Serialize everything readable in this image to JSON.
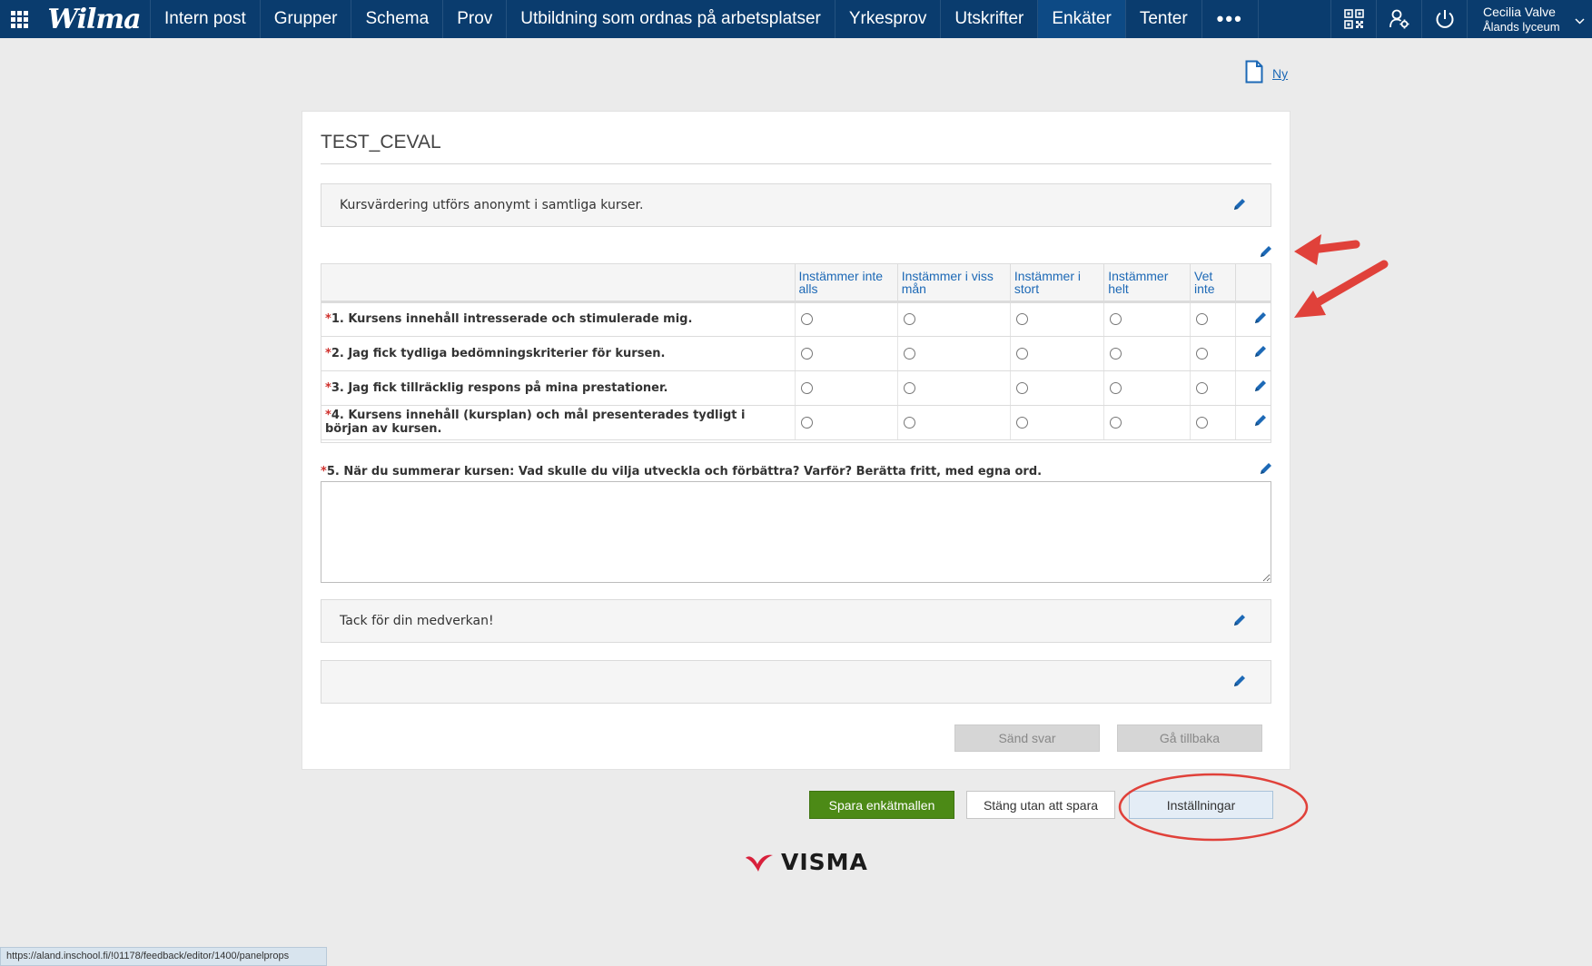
{
  "topbar": {
    "logo": "Wilma",
    "nav": [
      "Intern post",
      "Grupper",
      "Schema",
      "Prov",
      "Utbildning som ordnas på arbetsplatser",
      "Yrkesprov",
      "Utskrifter",
      "Enkäter",
      "Tenter"
    ],
    "active_item": "Enkäter",
    "more_label": "•••",
    "user_name": "Cecilia Valve",
    "user_school": "Ålands lyceum",
    "icons": [
      "apps-grid-icon",
      "qr-code-icon",
      "user-settings-icon",
      "power-icon",
      "chevron-down-icon"
    ]
  },
  "new_link": {
    "label": "Ny",
    "icon": "new-document-icon"
  },
  "form": {
    "title": "TEST_CEVAL",
    "intro_text": "Kursvärdering utförs anonymt i samtliga kurser.",
    "columns": [
      "Instämmer inte alls",
      "Instämmer i viss mån",
      "Instämmer i stort",
      "Instämmer helt",
      "Vet inte"
    ],
    "questions": [
      {
        "required_mark": "*",
        "text": "1. Kursens innehåll intresserade och stimulerade mig."
      },
      {
        "required_mark": "*",
        "text": "2. Jag fick tydliga bedömningskriterier för kursen."
      },
      {
        "required_mark": "*",
        "text": "3. Jag fick tillräcklig respons på mina prestationer."
      },
      {
        "required_mark": "*",
        "text": "4. Kursens innehåll (kursplan) och mål presenterades tydligt i början av kursen."
      }
    ],
    "open_question": {
      "required_mark": "*",
      "text": "5. När du summerar kursen: Vad skulle du vilja utveckla och förbättra? Varför? Berätta fritt, med egna ord.",
      "value": ""
    },
    "thanks_text": "Tack för din medverkan!",
    "empty_panel_text": "",
    "submit_label": "Sänd svar",
    "back_label": "Gå tillbaka"
  },
  "actions": {
    "save_label": "Spara enkätmallen",
    "close_label": "Stäng utan att spara",
    "settings_label": "Inställningar"
  },
  "footer": {
    "brand": "VISMA"
  },
  "statusbar": {
    "url": "https://aland.inschool.fi/!01178/feedback/editor/1400/panelprops"
  },
  "colors": {
    "topbar": "#0a3c6e",
    "link": "#1d69b6",
    "save": "#4c8a16",
    "annotation": "#e0413a"
  }
}
